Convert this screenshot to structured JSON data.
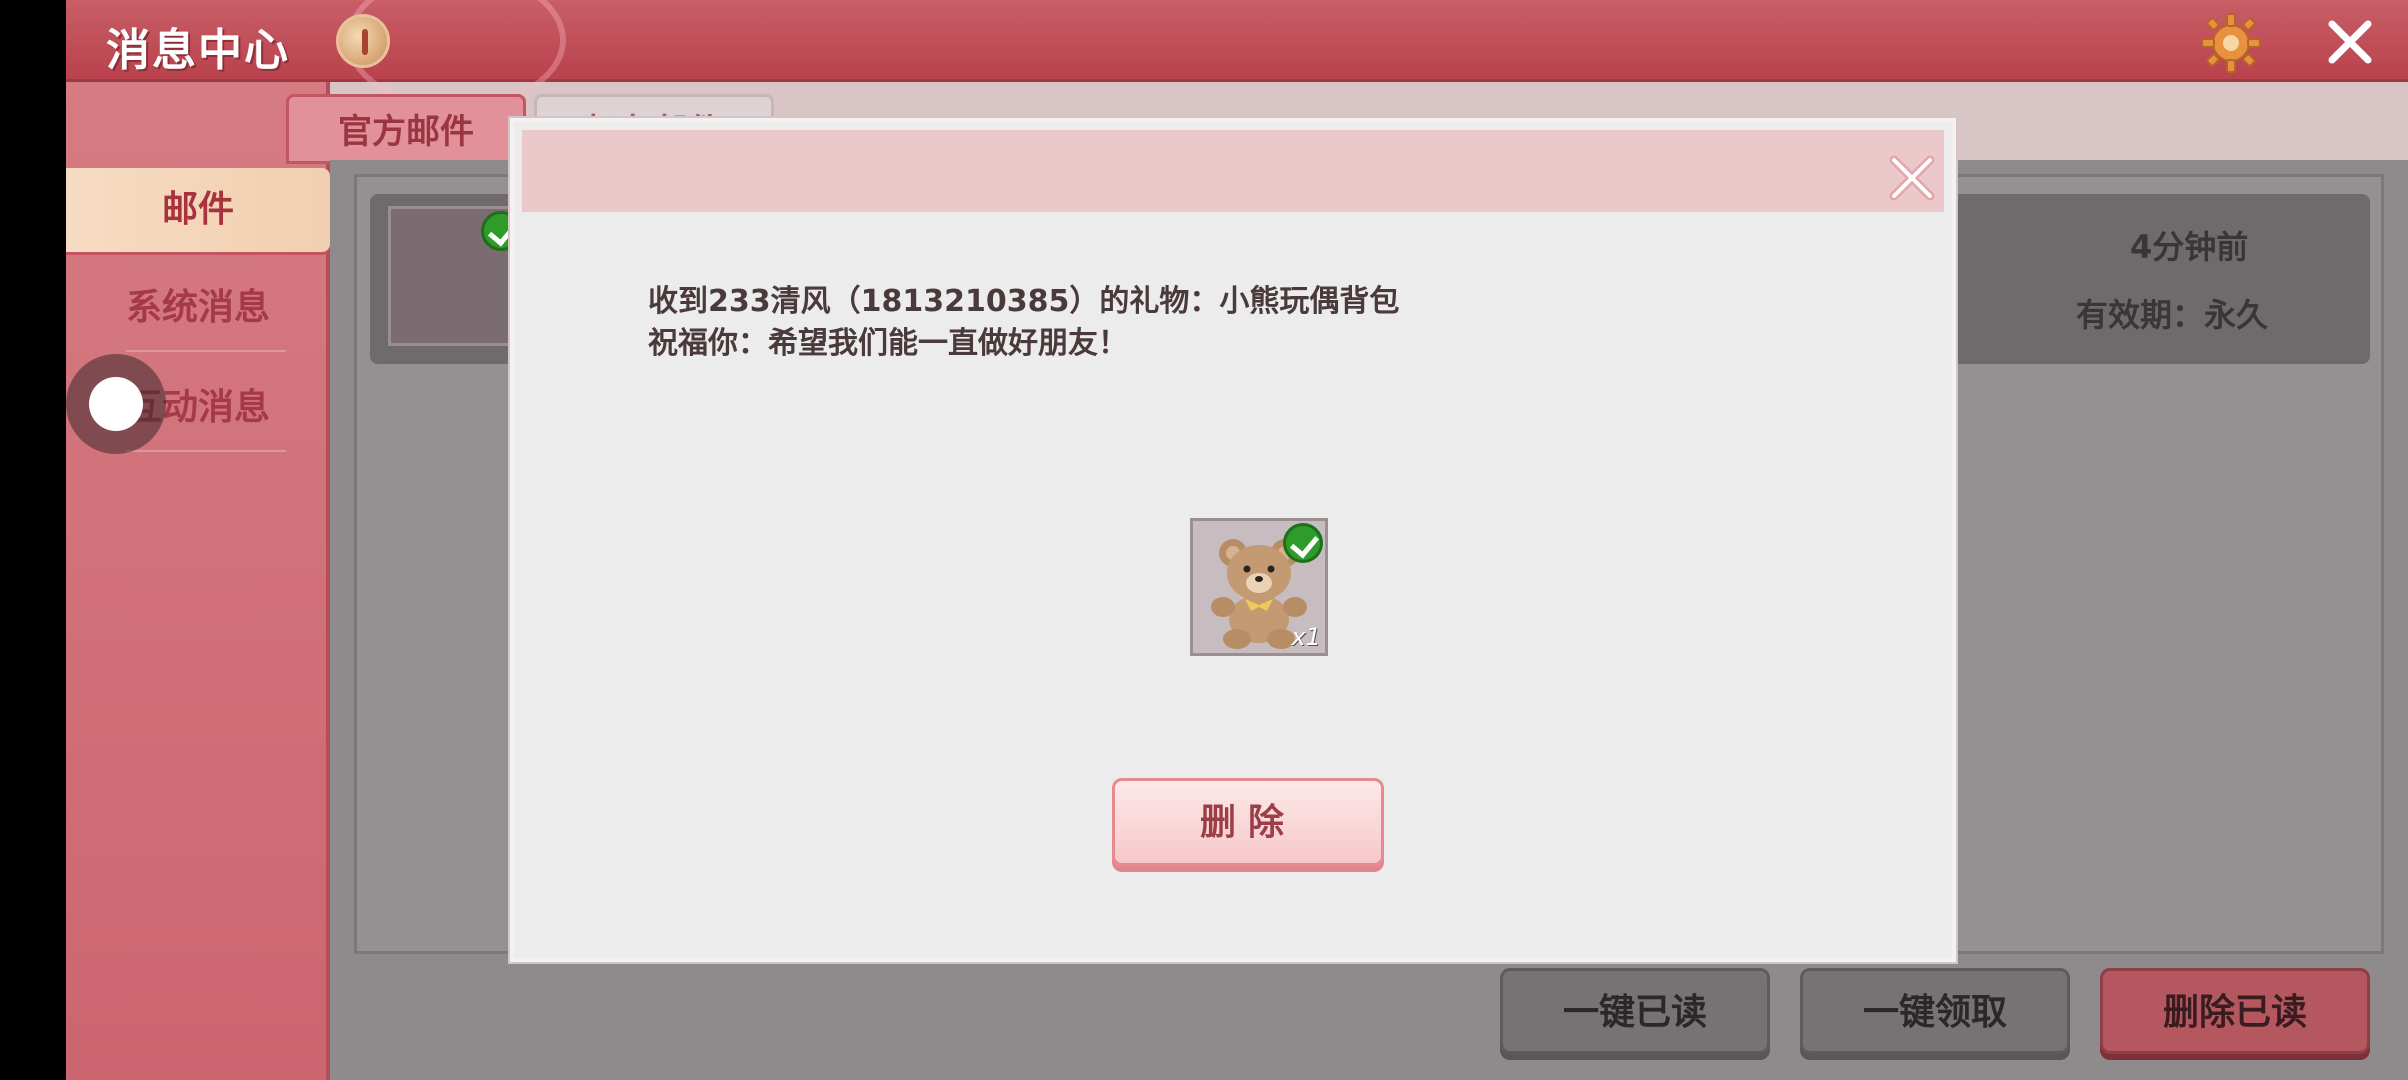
{
  "app": {
    "title": "消息中心"
  },
  "sidebar": {
    "items": [
      {
        "label": "邮件",
        "active": true
      },
      {
        "label": "系统消息",
        "active": false
      },
      {
        "label": "互动消息",
        "active": false
      }
    ]
  },
  "tabs": [
    {
      "label": "官方邮件",
      "active": true
    },
    {
      "label": "好友邮件",
      "active": false
    }
  ],
  "mail_list": {
    "items": [
      {
        "time": "4分钟前",
        "validity": "有效期：永久"
      }
    ]
  },
  "bottom_buttons": {
    "mark_all_read": "一键已读",
    "claim_all": "一键领取",
    "delete_read": "删除已读"
  },
  "dialog": {
    "message_line1": "收到233清风（1813210385）的礼物：小熊玩偶背包",
    "message_line2": "祝福你：希望我们能一直做好朋友！",
    "gift": {
      "icon": "teddy-bear-backpack-icon",
      "count": "x1"
    },
    "delete_label": "删除"
  },
  "colors": {
    "titlebar": "#c85e66",
    "sidebar": "#d67b82",
    "dialog_bg": "#ececec",
    "dialog_header": "#ebc9cb",
    "accent_red": "#b4575f"
  }
}
